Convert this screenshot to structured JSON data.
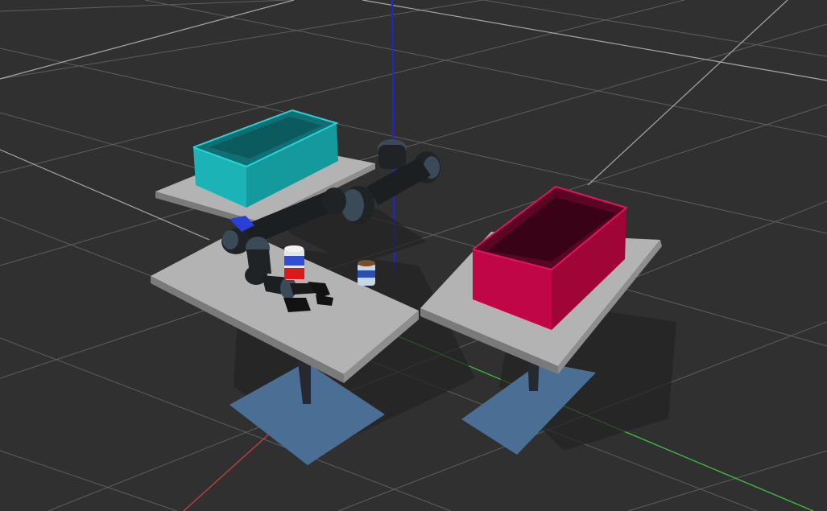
{
  "scene": {
    "background_color": "#303030",
    "grid_color": "#5e5e5e",
    "grid_accent_color": "#a8a8a8",
    "axis_colors": {
      "x": "#c84040",
      "y": "#3fbf3f",
      "z": "#2222dd"
    },
    "table_color": "#b3b3b3",
    "table_shadow_color": "#222222",
    "leg_color": "#262a30",
    "floor_plate_color": "#4b6e94",
    "bins": [
      {
        "id": "bin-cyan",
        "color": "#1bb3b6"
      },
      {
        "id": "bin-red",
        "color": "#c10648"
      }
    ],
    "robot": {
      "color": "#202325",
      "joint_color": "#3a4a58"
    },
    "objects": [
      {
        "id": "object-blue-block",
        "color": "#2a3fd8"
      },
      {
        "id": "object-can",
        "color": "#d81a1a"
      },
      {
        "id": "object-jar",
        "color": "#7a4e26"
      }
    ]
  }
}
